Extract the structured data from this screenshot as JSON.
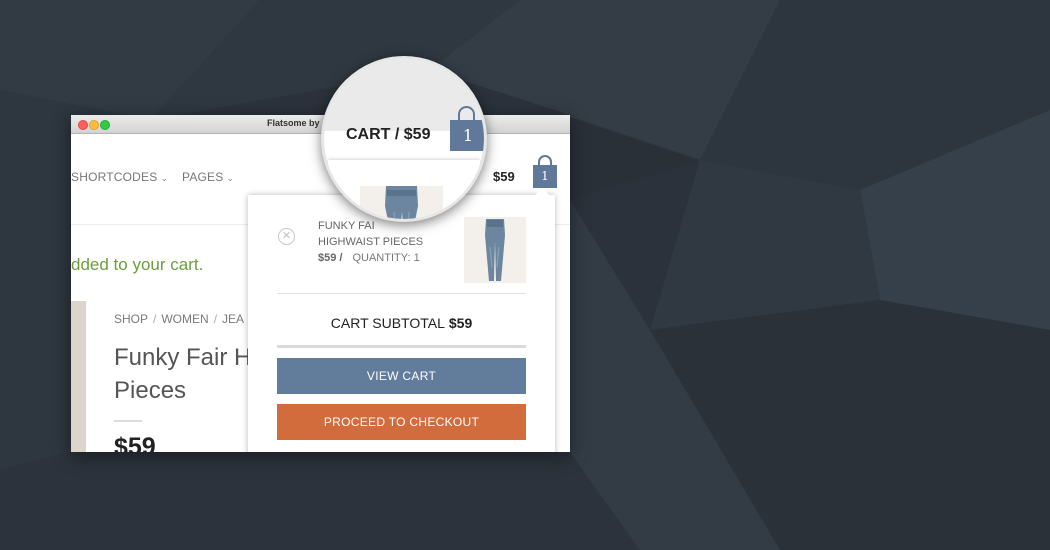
{
  "window": {
    "title": "Flatsome by"
  },
  "nav": {
    "items": [
      {
        "label": "SHORTCODES"
      },
      {
        "label": "PAGES"
      }
    ],
    "cart_price": "$59",
    "cart_count": "1"
  },
  "notice": {
    "text": "dded to your cart."
  },
  "product": {
    "breadcrumb": [
      "SHOP",
      "WOMEN",
      "JEA"
    ],
    "title_line1": "Funky Fair H",
    "title_line2": "Pieces",
    "price": "$59"
  },
  "mini_cart": {
    "item": {
      "name_line1": "FUNKY FAI",
      "name_line2": "HIGHWAIST PIECES",
      "price": "$59 /",
      "quantity": "QUANTITY: 1"
    },
    "subtotal_label": "CART SUBTOTAL",
    "subtotal_value": "$59",
    "view_cart_label": "VIEW CART",
    "checkout_label": "PROCEED TO CHECKOUT"
  },
  "magnifier": {
    "cart_label": "CART / $59",
    "cart_count": "1"
  },
  "colors": {
    "background": "#2b323b",
    "accent_blue": "#627c9c",
    "checkout_orange": "#d26c3c",
    "notice_green": "#6d9d3e"
  }
}
